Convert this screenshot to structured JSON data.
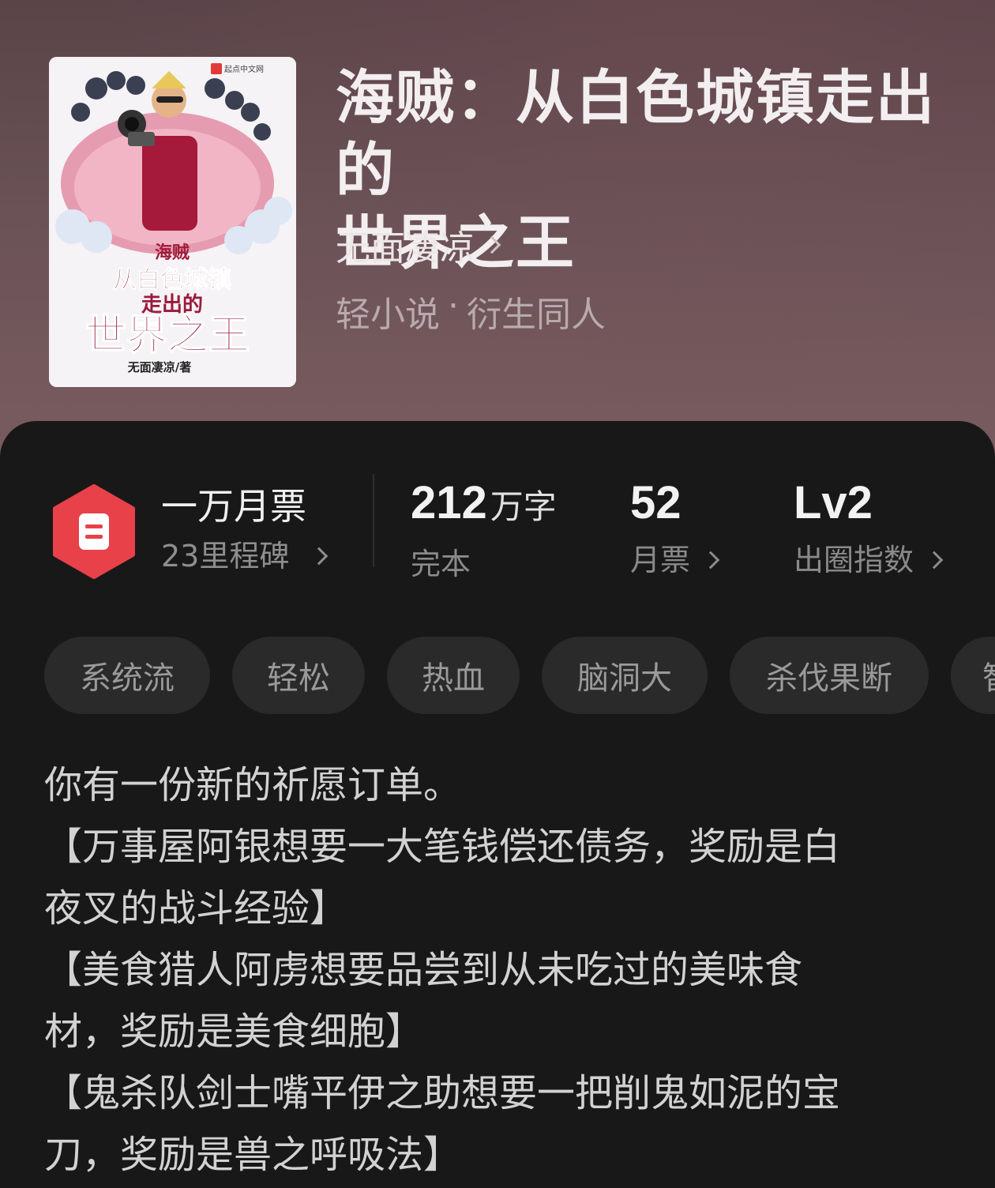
{
  "book": {
    "title_line1": "海贼：从白色城镇走出的",
    "title_line2": "世界之王",
    "author": "无面凄凉",
    "category": "轻小说",
    "subcategory": "衍生同人",
    "separator": "·"
  },
  "cover": {
    "publisher_mark": "起点中文网",
    "art_title_top": "海贼",
    "art_title_line1": "从白色城镇",
    "art_title_line2": "走出的",
    "art_title_line3": "世界之王",
    "art_author": "无面凄凉/著"
  },
  "stats": {
    "monthly_title": "一万月票",
    "monthly_sub": "23里程碑",
    "word_count": "212",
    "word_unit": "万字",
    "status": "完本",
    "tickets": "52",
    "tickets_label": "月票",
    "level": "Lv2",
    "level_label": "出圈指数"
  },
  "tags": [
    "系统流",
    "轻松",
    "热血",
    "脑洞大",
    "杀伐果断",
    "智"
  ],
  "description": [
    "你有一份新的祈愿订单。",
    "【万事屋阿银想要一大笔钱偿还债务，奖励是白",
    "夜叉的战斗经验】",
    "【美食猎人阿虏想要品尝到从未吃过的美味食",
    "材，奖励是美食细胞】",
    "【鬼杀队剑士嘴平伊之助想要一把削鬼如泥的宝",
    "刀，奖励是兽之呼吸法】"
  ],
  "colors": {
    "badge_red": "#e8414a",
    "sheet_bg": "#181818",
    "tag_bg": "#2a2a2a"
  }
}
